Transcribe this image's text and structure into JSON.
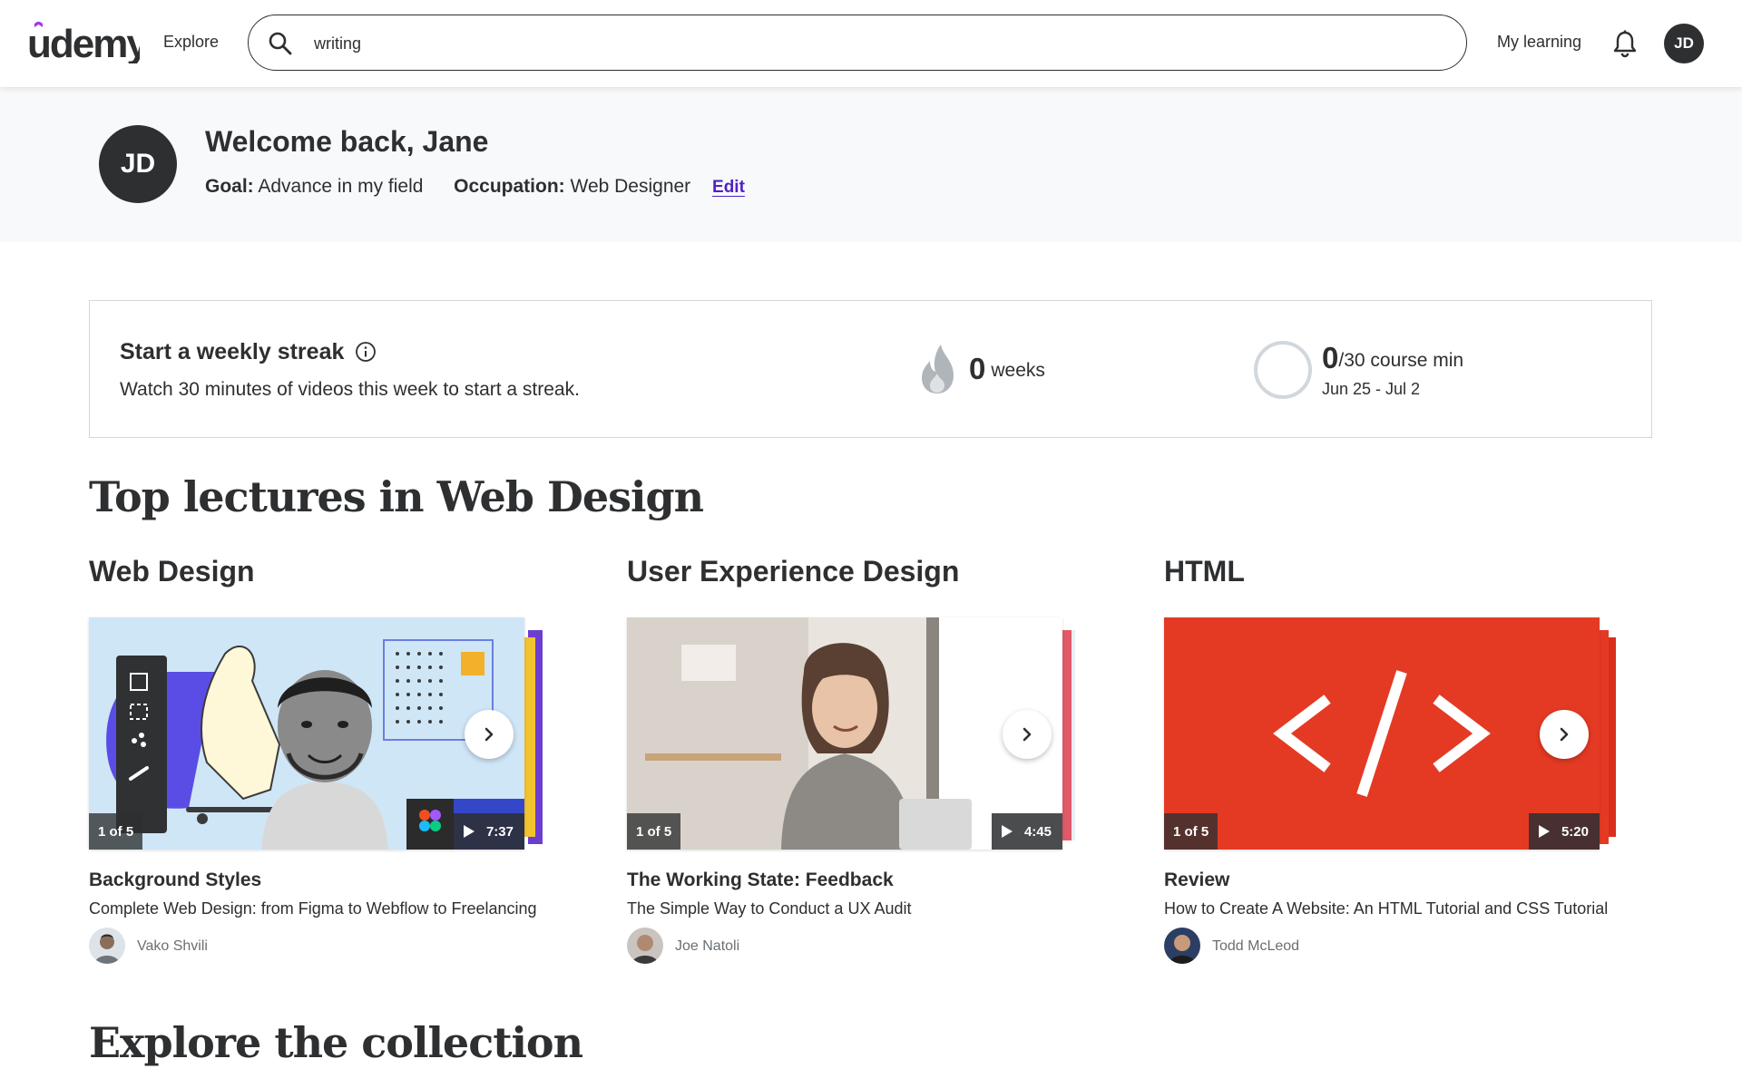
{
  "header": {
    "logo_text": "udemy",
    "explore_label": "Explore",
    "search_value": "writing",
    "my_learning_label": "My learning",
    "avatar_initials": "JD",
    "icons": [
      "search-icon",
      "bell-icon"
    ]
  },
  "welcome": {
    "avatar_initials": "JD",
    "title": "Welcome back, Jane",
    "goal_label": "Goal:",
    "goal_value": "Advance in my field",
    "occupation_label": "Occupation:",
    "occupation_value": "Web Designer",
    "edit_label": "Edit"
  },
  "streak": {
    "title": "Start a weekly streak",
    "subtitle": "Watch 30 minutes of videos this week to start a streak.",
    "weeks_value": "0",
    "weeks_label": "weeks",
    "minutes_value": "0",
    "minutes_suffix": "/30 course min",
    "minutes_progress": 0,
    "date_range": "Jun 25 - Jul 2"
  },
  "top_lectures": {
    "heading": "Top lectures in Web Design",
    "columns": [
      {
        "category": "Web Design",
        "index_label": "1 of 5",
        "duration": "7:37",
        "lecture_title": "Background Styles",
        "course_name": "Complete Web Design: from Figma to Webflow to Freelancing",
        "instructor": "Vako Shvili"
      },
      {
        "category": "User Experience Design",
        "index_label": "1 of 5",
        "duration": "4:45",
        "lecture_title": "The Working State: Feedback",
        "course_name": "The Simple Way to Conduct a UX Audit",
        "instructor": "Joe Natoli"
      },
      {
        "category": "HTML",
        "index_label": "1 of 5",
        "duration": "5:20",
        "lecture_title": "Review",
        "course_name": "How to Create A Website: An HTML Tutorial and CSS Tutorial",
        "instructor": "Todd McLeod"
      }
    ]
  },
  "explore": {
    "heading": "Explore the collection"
  },
  "colors": {
    "text": "#2d2f31",
    "brand_purple": "#a435f0",
    "link_purple": "#5022c3",
    "band_bg": "#f7f9fa",
    "html_red": "#e43a24"
  }
}
